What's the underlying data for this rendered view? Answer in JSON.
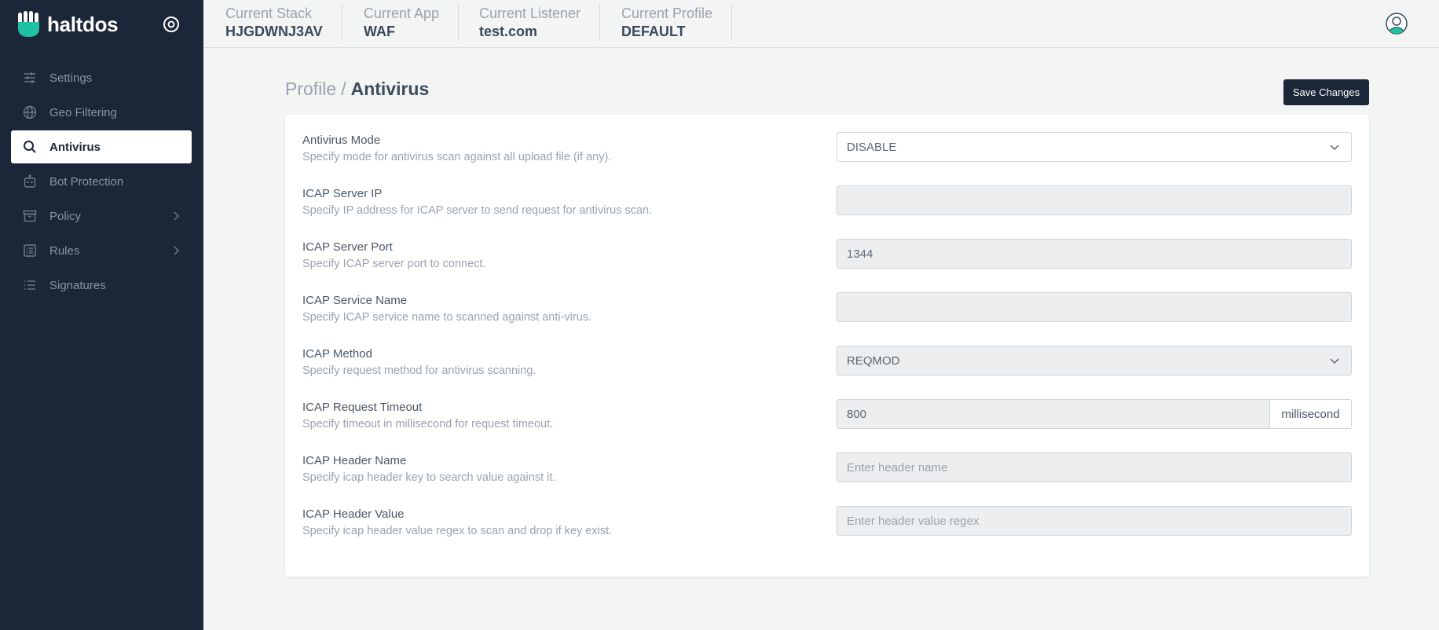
{
  "app": {
    "brand_name": "haltdos",
    "brand_color": "#1fc0a3",
    "sidebar_bg": "#1b2638"
  },
  "sidebar": {
    "items": [
      {
        "label": "Settings",
        "icon": "sliders-icon",
        "active": false,
        "has_children": false
      },
      {
        "label": "Geo Filtering",
        "icon": "globe-icon",
        "active": false,
        "has_children": false
      },
      {
        "label": "Antivirus",
        "icon": "search-icon",
        "active": true,
        "has_children": false
      },
      {
        "label": "Bot Protection",
        "icon": "robot-icon",
        "active": false,
        "has_children": false
      },
      {
        "label": "Policy",
        "icon": "archive-icon",
        "active": false,
        "has_children": true
      },
      {
        "label": "Rules",
        "icon": "list-box-icon",
        "active": false,
        "has_children": true
      },
      {
        "label": "Signatures",
        "icon": "list-icon",
        "active": false,
        "has_children": false
      }
    ]
  },
  "header": {
    "context": [
      {
        "label": "Current Stack",
        "value": "HJGDWNJ3AV"
      },
      {
        "label": "Current App",
        "value": "WAF"
      },
      {
        "label": "Current Listener",
        "value": "test.com"
      },
      {
        "label": "Current Profile",
        "value": "DEFAULT"
      }
    ]
  },
  "page": {
    "breadcrumb_parent": "Profile",
    "breadcrumb_separator": "/",
    "breadcrumb_current": "Antivirus",
    "save_label": "Save Changes"
  },
  "form": {
    "fields": [
      {
        "label": "Antivirus Mode",
        "help": "Specify mode for antivirus scan against all upload file (if any).",
        "type": "select",
        "value": "DISABLE"
      },
      {
        "label": "ICAP Server IP",
        "help": "Specify IP address for ICAP server to send request for antivirus scan.",
        "type": "text",
        "value": "",
        "placeholder": ""
      },
      {
        "label": "ICAP Server Port",
        "help": "Specify ICAP server port to connect.",
        "type": "text",
        "value": "1344",
        "placeholder": ""
      },
      {
        "label": "ICAP Service Name",
        "help": "Specify ICAP service name to scanned against anti-virus.",
        "type": "text",
        "value": "",
        "placeholder": ""
      },
      {
        "label": "ICAP Method",
        "help": "Specify request method for antivirus scanning.",
        "type": "select",
        "value": "REQMOD"
      },
      {
        "label": "ICAP Request Timeout",
        "help": "Specify timeout in millisecond for request timeout.",
        "type": "text",
        "value": "800",
        "addon": "millisecond"
      },
      {
        "label": "ICAP Header Name",
        "help": "Specify icap header key to search value against it.",
        "type": "text",
        "value": "",
        "placeholder": "Enter header name"
      },
      {
        "label": "ICAP Header Value",
        "help": "Specify icap header value regex to scan and drop if key exist.",
        "type": "text",
        "value": "",
        "placeholder": "Enter header value regex"
      }
    ]
  }
}
